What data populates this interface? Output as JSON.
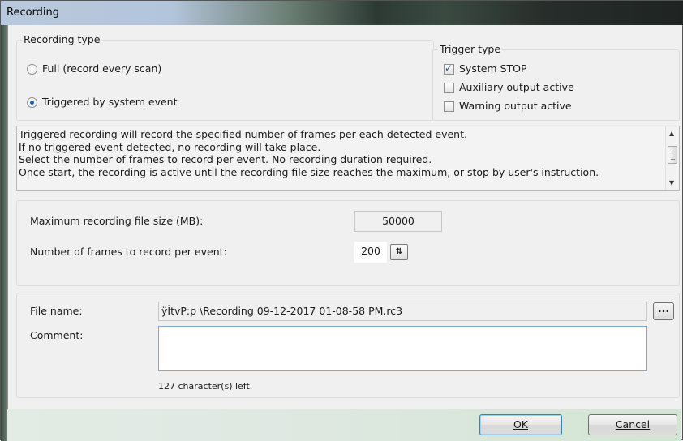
{
  "window": {
    "title": "Recording"
  },
  "recording_type": {
    "label": "Recording type",
    "options": [
      {
        "label": "Full (record every scan)",
        "selected": false
      },
      {
        "label": "Triggered by system event",
        "selected": true
      }
    ]
  },
  "trigger_type": {
    "label": "Trigger type",
    "options": [
      {
        "label": "System STOP",
        "checked": true
      },
      {
        "label": "Auxiliary output active",
        "checked": false
      },
      {
        "label": "Warning output active",
        "checked": false
      }
    ]
  },
  "info": {
    "lines": [
      "Triggered recording will record the specified number of frames per each detected event.",
      "If no triggered event detected, no recording will take place.",
      "Select the number of frames to record per event. No recording duration required.",
      "Once start, the recording is active until the recording file size reaches the maximum, or stop by user's instruction."
    ]
  },
  "settings": {
    "max_size_label": "Maximum recording file size (MB):",
    "max_size_value": "50000",
    "frames_label": "Number of frames to record per event:",
    "frames_value": "200"
  },
  "file": {
    "name_label": "File name:",
    "name_value": "ÿÎtvP:p   \\Recording 09-12-2017  01-08-58 PM.rc3",
    "browse_label": "...",
    "comment_label": "Comment:",
    "comment_value": "",
    "chars_left": "127 character(s) left."
  },
  "buttons": {
    "ok": "OK",
    "cancel": "Cancel"
  },
  "colors": {
    "accent": "#1f5fa8",
    "footer": "#d3e5d3"
  }
}
